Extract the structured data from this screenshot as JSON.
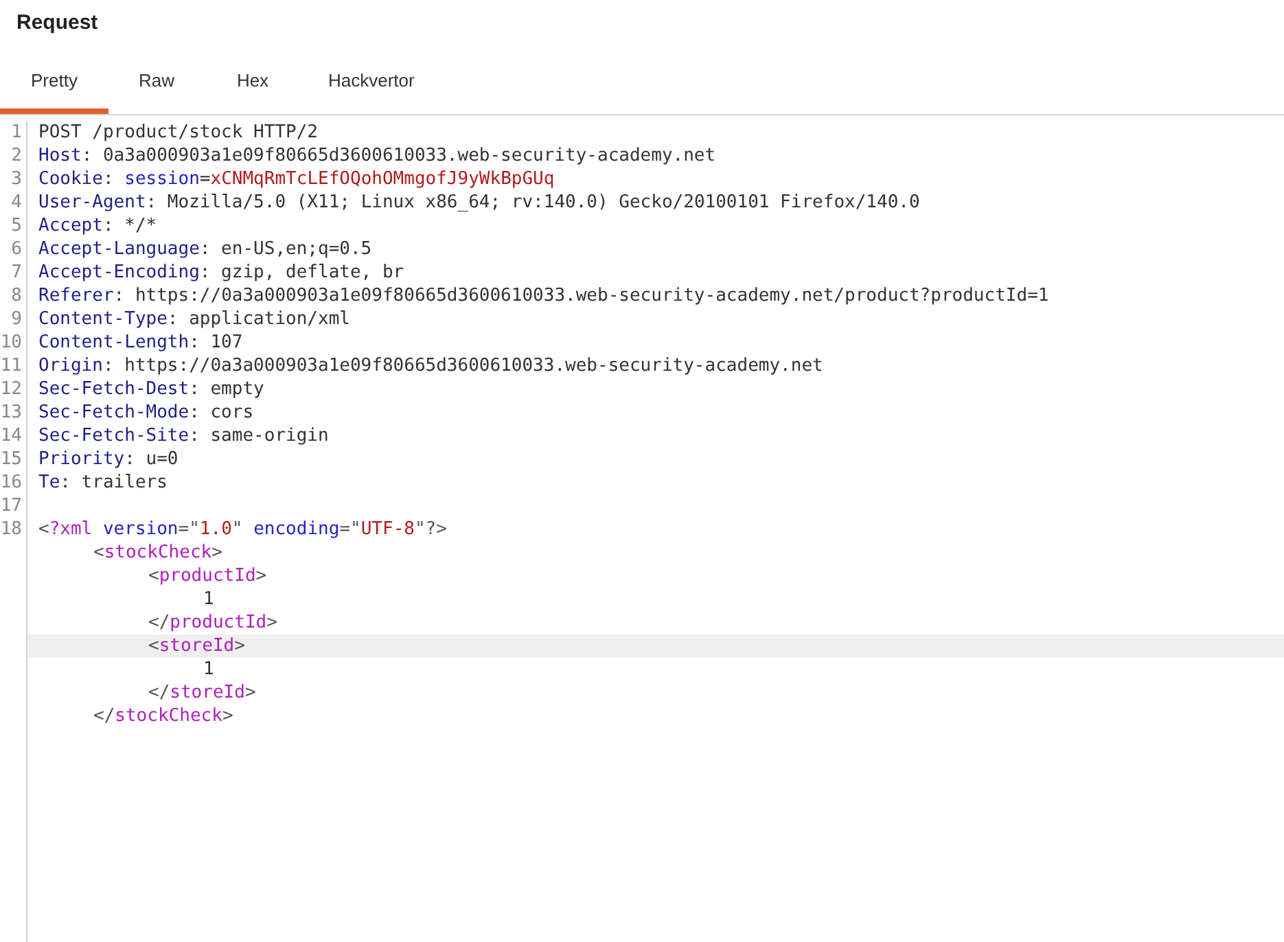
{
  "title": "Request",
  "tabs": [
    {
      "label": "Pretty",
      "selected": true
    },
    {
      "label": "Raw",
      "selected": false
    },
    {
      "label": "Hex",
      "selected": false
    },
    {
      "label": "Hackvertor",
      "selected": false
    }
  ],
  "lines": [
    {
      "number": "1",
      "tokens": [
        {
          "kind": "plain",
          "text": "POST /product/stock HTTP/2"
        }
      ]
    },
    {
      "number": "2",
      "tokens": [
        {
          "kind": "key",
          "text": "Host"
        },
        {
          "kind": "plain",
          "text": ": 0a3a000903a1e09f80665d3600610033.web-security-academy.net"
        }
      ]
    },
    {
      "number": "3",
      "tokens": [
        {
          "kind": "key",
          "text": "Cookie"
        },
        {
          "kind": "plain",
          "text": ": "
        },
        {
          "kind": "name",
          "text": "session"
        },
        {
          "kind": "plain",
          "text": "="
        },
        {
          "kind": "value",
          "text": "xCNMqRmTcLEfOQohOMmgofJ9yWkBpGUq"
        }
      ]
    },
    {
      "number": "4",
      "tokens": [
        {
          "kind": "key",
          "text": "User-Agent"
        },
        {
          "kind": "plain",
          "text": ": Mozilla/5.0 (X11; Linux x86_64; rv:140.0) Gecko/20100101 Firefox/140.0"
        }
      ]
    },
    {
      "number": "5",
      "tokens": [
        {
          "kind": "key",
          "text": "Accept"
        },
        {
          "kind": "plain",
          "text": ": */*"
        }
      ]
    },
    {
      "number": "6",
      "tokens": [
        {
          "kind": "key",
          "text": "Accept-Language"
        },
        {
          "kind": "plain",
          "text": ": en-US,en;q=0.5"
        }
      ]
    },
    {
      "number": "7",
      "tokens": [
        {
          "kind": "key",
          "text": "Accept-Encoding"
        },
        {
          "kind": "plain",
          "text": ": gzip, deflate, br"
        }
      ]
    },
    {
      "number": "8",
      "tokens": [
        {
          "kind": "key",
          "text": "Referer"
        },
        {
          "kind": "plain",
          "text": ": https://0a3a000903a1e09f80665d3600610033.web-security-academy.net/product?productId=1"
        }
      ]
    },
    {
      "number": "9",
      "tokens": [
        {
          "kind": "key",
          "text": "Content-Type"
        },
        {
          "kind": "plain",
          "text": ": application/xml"
        }
      ]
    },
    {
      "number": "10",
      "tokens": [
        {
          "kind": "key",
          "text": "Content-Length"
        },
        {
          "kind": "plain",
          "text": ": 107"
        }
      ]
    },
    {
      "number": "11",
      "tokens": [
        {
          "kind": "key",
          "text": "Origin"
        },
        {
          "kind": "plain",
          "text": ": https://0a3a000903a1e09f80665d3600610033.web-security-academy.net"
        }
      ]
    },
    {
      "number": "12",
      "tokens": [
        {
          "kind": "key",
          "text": "Sec-Fetch-Dest"
        },
        {
          "kind": "plain",
          "text": ": empty"
        }
      ]
    },
    {
      "number": "13",
      "tokens": [
        {
          "kind": "key",
          "text": "Sec-Fetch-Mode"
        },
        {
          "kind": "plain",
          "text": ": cors"
        }
      ]
    },
    {
      "number": "14",
      "tokens": [
        {
          "kind": "key",
          "text": "Sec-Fetch-Site"
        },
        {
          "kind": "plain",
          "text": ": same-origin"
        }
      ]
    },
    {
      "number": "15",
      "tokens": [
        {
          "kind": "key",
          "text": "Priority"
        },
        {
          "kind": "plain",
          "text": ": u=0"
        }
      ]
    },
    {
      "number": "16",
      "tokens": [
        {
          "kind": "key",
          "text": "Te"
        },
        {
          "kind": "plain",
          "text": ": trailers"
        }
      ]
    },
    {
      "number": "17"
    },
    {
      "number": "18",
      "tokens": [
        {
          "kind": "bracket",
          "text": "<"
        },
        {
          "kind": "tag",
          "text": "?xml"
        },
        {
          "kind": "name",
          "text": " version"
        },
        {
          "kind": "bracket",
          "text": "=\""
        },
        {
          "kind": "value",
          "text": "1.0"
        },
        {
          "kind": "bracket",
          "text": "\" "
        },
        {
          "kind": "name",
          "text": "encoding"
        },
        {
          "kind": "bracket",
          "text": "=\""
        },
        {
          "kind": "value",
          "text": "UTF-8"
        },
        {
          "kind": "bracket",
          "text": "\"?>"
        }
      ],
      "children": [
        {
          "highlighted": false,
          "tokens": [
            {
              "kind": "bracket",
              "text": "<"
            },
            {
              "kind": "tag",
              "text": "stockCheck"
            },
            {
              "kind": "bracket",
              "text": ">"
            }
          ],
          "children": [
            {
              "highlighted": false,
              "tokens": [
                {
                  "kind": "bracket",
                  "text": "<"
                },
                {
                  "kind": "tag",
                  "text": "productId"
                },
                {
                  "kind": "bracket",
                  "text": ">"
                }
              ],
              "children": [
                {
                  "highlighted": false,
                  "tokens": [
                    {
                      "kind": "plain",
                      "text": "1"
                    }
                  ]
                }
              ]
            },
            {
              "highlighted": false,
              "tokens": [
                {
                  "kind": "bracket",
                  "text": "</"
                },
                {
                  "kind": "tag",
                  "text": "productId"
                },
                {
                  "kind": "bracket",
                  "text": ">"
                }
              ]
            },
            {
              "highlighted": true,
              "tokens": [
                {
                  "kind": "bracket",
                  "text": "<"
                },
                {
                  "kind": "tag",
                  "text": "storeId"
                },
                {
                  "kind": "bracket",
                  "text": ">"
                }
              ],
              "children": [
                {
                  "highlighted": false,
                  "tokens": [
                    {
                      "kind": "plain",
                      "text": "1"
                    }
                  ]
                }
              ]
            },
            {
              "highlighted": false,
              "tokens": [
                {
                  "kind": "bracket",
                  "text": "</"
                },
                {
                  "kind": "tag",
                  "text": "storeId"
                },
                {
                  "kind": "bracket",
                  "text": ">"
                }
              ]
            }
          ]
        },
        {
          "highlighted": false,
          "tokens": [
            {
              "kind": "bracket",
              "text": "</"
            },
            {
              "kind": "tag",
              "text": "stockCheck"
            },
            {
              "kind": "bracket",
              "text": ">"
            }
          ]
        }
      ]
    }
  ]
}
